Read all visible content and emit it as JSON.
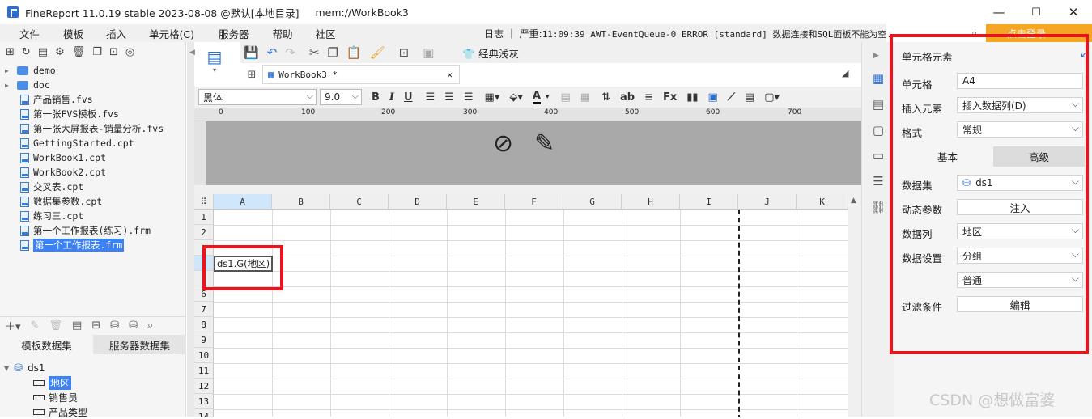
{
  "titlebar": {
    "title": "FineReport 11.0.19 stable 2023-08-08 @默认[本地目录]",
    "path": "mem://WorkBook3"
  },
  "window_buttons": {
    "minimize": "—",
    "maximize": "☐",
    "close": "✕"
  },
  "menu": [
    "文件",
    "模板",
    "插入",
    "单元格(C)",
    "服务器",
    "帮助",
    "社区"
  ],
  "log": {
    "prefix": "日志 ｜ 严重:",
    "message": "11:09:39 AWT-EventQueue-0 ERROR [standard] 数据连接和SQL面板不能为空."
  },
  "login_label": "点击登录",
  "tree": {
    "folders": [
      "demo",
      "doc"
    ],
    "files": [
      "产品销售.fvs",
      "第一张FVS模板.fvs",
      "第一张大屏报表-销量分析.fvs",
      "GettingStarted.cpt",
      "WorkBook1.cpt",
      "WorkBook2.cpt",
      "交叉表.cpt",
      "数据集参数.cpt",
      "练习三.cpt",
      "第一个工作报表(练习).frm",
      "第一个工作报表.frm"
    ],
    "selected": "第一个工作报表.frm"
  },
  "dataset_tabs": [
    "模板数据集",
    "服务器数据集"
  ],
  "dataset": {
    "name": "ds1",
    "fields": [
      "地区",
      "销售员",
      "产品类型"
    ],
    "selected_field": "地区"
  },
  "toolbar": {
    "theme_label": "经典浅灰"
  },
  "tab": {
    "label": "WorkBook3 *"
  },
  "format": {
    "font": "黑体",
    "size": "9.0"
  },
  "ruler_marks": [
    "0",
    "100",
    "200",
    "300",
    "400",
    "500",
    "600",
    "700"
  ],
  "columns": [
    "A",
    "B",
    "C",
    "D",
    "E",
    "F",
    "G",
    "H",
    "I",
    "J",
    "K"
  ],
  "rows": [
    "1",
    "2",
    "",
    "",
    "",
    "6",
    "7",
    "8",
    "9",
    "10",
    "11",
    "12",
    "13",
    "14"
  ],
  "cell": {
    "address": "A4",
    "content": "ds1.G(地区)"
  },
  "panel": {
    "title": "单元格元素",
    "cell_label": "单元格",
    "cell_value": "A4",
    "insert_label": "插入元素",
    "insert_value": "插入数据列(D)",
    "format_label": "格式",
    "format_value": "常规",
    "tab_basic": "基本",
    "tab_advanced": "高级",
    "dataset_label": "数据集",
    "dataset_value": "ds1",
    "dyn_param_label": "动态参数",
    "dyn_param_button": "注入",
    "column_label": "数据列",
    "column_value": "地区",
    "setting_label": "数据设置",
    "setting_value": "分组",
    "setting_value2": "普通",
    "filter_label": "过滤条件",
    "filter_button": "编辑"
  },
  "watermark": "CSDN @想做富婆",
  "colors": {
    "accent": "#3b82f6",
    "highlight": "#e8141e",
    "login": "#f5a623"
  }
}
